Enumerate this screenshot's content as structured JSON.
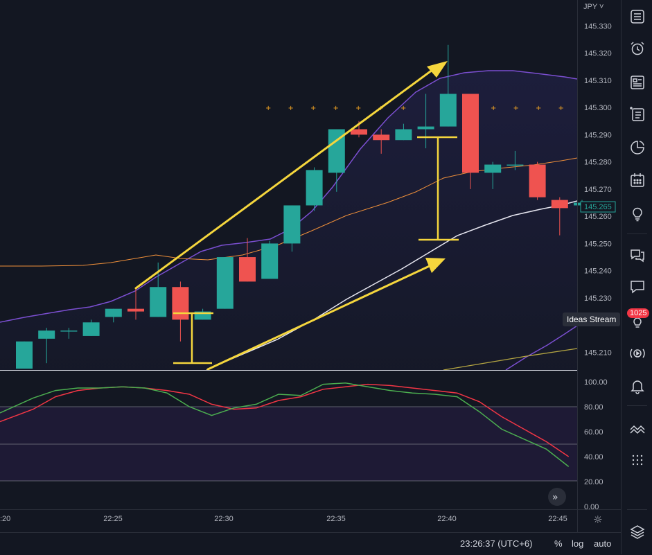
{
  "currency": {
    "label": "JPY",
    "chevron_icon": "chevron-down-icon"
  },
  "price_axis": {
    "ticks": [
      "145.330",
      "145.320",
      "145.310",
      "145.300",
      "145.290",
      "145.280",
      "145.270",
      "145.260",
      "145.250",
      "145.240",
      "145.230",
      "145.210"
    ],
    "current_price_label": "145.265",
    "current_price_color": "#26a69a"
  },
  "oscillator_axis": {
    "ticks": [
      "100.00",
      "80.00",
      "60.00",
      "40.00",
      "20.00",
      "0.00"
    ]
  },
  "time_axis": {
    "ticks": [
      ":20",
      "22:25",
      "22:30",
      "22:35",
      "22:40",
      "22:45"
    ]
  },
  "bottom_bar": {
    "clock": "23:26:37 (UTC+6)",
    "percent_label": "%",
    "log_label": "log",
    "auto_label": "auto"
  },
  "sidebar": {
    "items": [
      {
        "icon": "watchlist-icon"
      },
      {
        "icon": "alarm-clock-icon"
      },
      {
        "icon": "news-icon"
      },
      {
        "icon": "data-window-icon"
      },
      {
        "icon": "hotlist-icon"
      },
      {
        "icon": "calendar-icon"
      },
      {
        "icon": "lightbulb-icon"
      },
      {
        "icon": "chats-icon"
      },
      {
        "icon": "chat-icon"
      },
      {
        "icon": "ideas-stream-icon"
      },
      {
        "icon": "streams-icon"
      },
      {
        "icon": "notifications-bell-icon"
      },
      {
        "icon": "trend-icon"
      },
      {
        "icon": "dots-grid-icon"
      },
      {
        "icon": "layers-icon"
      }
    ],
    "ideas_badge": "1025",
    "ideas_tooltip": "Ideas Stream"
  },
  "colors": {
    "background": "#131722",
    "up": "#26a69a",
    "down": "#ef5350",
    "annotation": "#f5d63d",
    "bb_upper": "#7b4fd1",
    "ma_orange": "#f0903a",
    "ma_white": "#e6e6f0",
    "ma_olive": "#b5a642",
    "osc_red": "#f23645",
    "osc_green": "#4caf50"
  },
  "chart_data": {
    "type": "candlestick",
    "price_range": [
      145.2035,
      145.3395
    ],
    "candles": [
      {
        "o": 145.204,
        "h": 145.214,
        "l": 145.204,
        "c": 145.214
      },
      {
        "o": 145.215,
        "h": 145.219,
        "l": 145.206,
        "c": 145.218
      },
      {
        "o": 145.218,
        "h": 145.219,
        "l": 145.215,
        "c": 145.218
      },
      {
        "o": 145.216,
        "h": 145.222,
        "l": 145.216,
        "c": 145.221
      },
      {
        "o": 145.223,
        "h": 145.226,
        "l": 145.221,
        "c": 145.226
      },
      {
        "o": 145.226,
        "h": 145.234,
        "l": 145.222,
        "c": 145.225
      },
      {
        "o": 145.223,
        "h": 145.243,
        "l": 145.223,
        "c": 145.234
      },
      {
        "o": 145.234,
        "h": 145.236,
        "l": 145.214,
        "c": 145.222
      },
      {
        "o": 145.222,
        "h": 145.226,
        "l": 145.222,
        "c": 145.225
      },
      {
        "o": 145.226,
        "h": 145.245,
        "l": 145.226,
        "c": 145.245
      },
      {
        "o": 145.245,
        "h": 145.252,
        "l": 145.236,
        "c": 145.236
      },
      {
        "o": 145.237,
        "h": 145.251,
        "l": 145.237,
        "c": 145.25
      },
      {
        "o": 145.25,
        "h": 145.264,
        "l": 145.247,
        "c": 145.264
      },
      {
        "o": 145.264,
        "h": 145.278,
        "l": 145.262,
        "c": 145.277
      },
      {
        "o": 145.276,
        "h": 145.292,
        "l": 145.269,
        "c": 145.292
      },
      {
        "o": 145.292,
        "h": 145.295,
        "l": 145.289,
        "c": 145.29
      },
      {
        "o": 145.29,
        "h": 145.292,
        "l": 145.283,
        "c": 145.288
      },
      {
        "o": 145.288,
        "h": 145.294,
        "l": 145.288,
        "c": 145.292
      },
      {
        "o": 145.292,
        "h": 145.305,
        "l": 145.285,
        "c": 145.293
      },
      {
        "o": 145.293,
        "h": 145.323,
        "l": 145.293,
        "c": 145.305
      },
      {
        "o": 145.305,
        "h": 145.305,
        "l": 145.27,
        "c": 145.276
      },
      {
        "o": 145.276,
        "h": 145.28,
        "l": 145.27,
        "c": 145.279
      },
      {
        "o": 145.279,
        "h": 145.284,
        "l": 145.277,
        "c": 145.279
      },
      {
        "o": 145.279,
        "h": 145.28,
        "l": 145.266,
        "c": 145.267
      },
      {
        "o": 145.266,
        "h": 145.267,
        "l": 145.253,
        "c": 145.263
      },
      {
        "o": 145.264,
        "h": 145.266,
        "l": 145.263,
        "c": 145.265
      }
    ],
    "oscillator": {
      "range": [
        0,
        100
      ],
      "upper_band": 80,
      "lower_band": 20,
      "red": [
        68,
        78,
        88,
        93,
        95,
        96,
        95,
        93,
        90,
        82,
        78,
        79,
        85,
        88,
        94,
        96,
        98,
        97,
        95,
        93,
        91,
        84,
        72,
        62,
        52,
        40
      ],
      "green": [
        75,
        87,
        93,
        95,
        95,
        96,
        95,
        91,
        80,
        73,
        79,
        82,
        90,
        89,
        98,
        99,
        96,
        93,
        91,
        90,
        88,
        76,
        62,
        54,
        46,
        32
      ]
    }
  }
}
